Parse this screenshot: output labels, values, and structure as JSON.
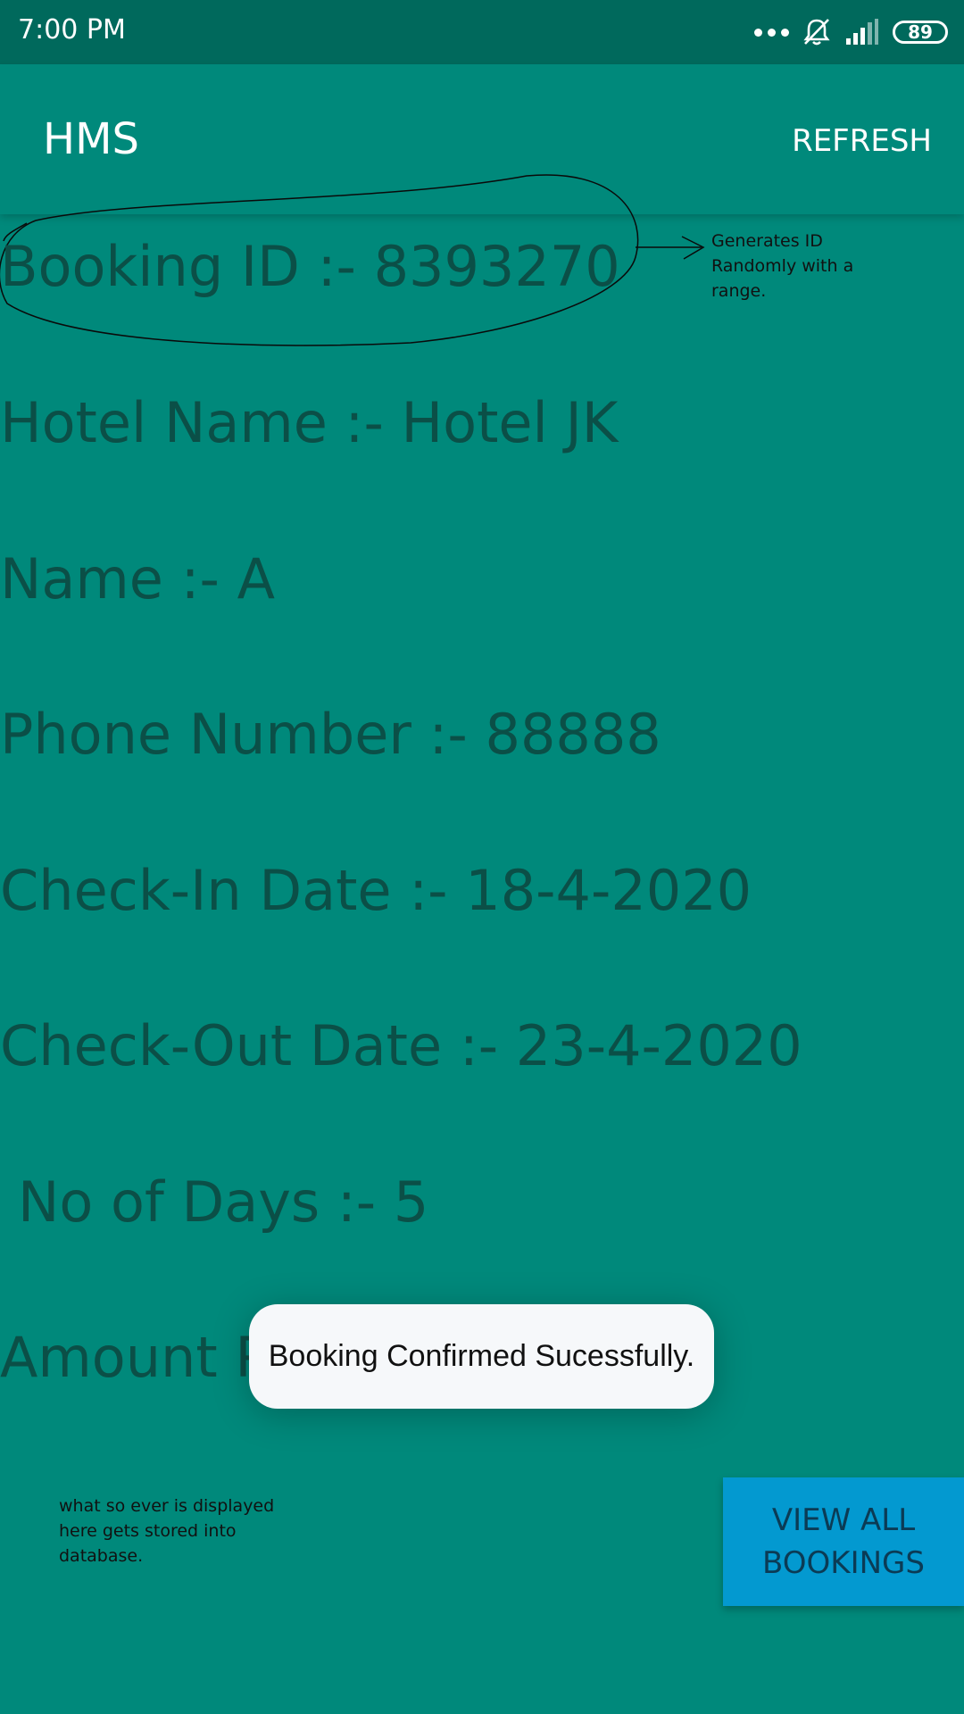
{
  "status_bar": {
    "time": "7:00 PM",
    "battery": "89",
    "icons": [
      "more-dots-icon",
      "bell-off-icon",
      "signal-icon",
      "battery-icon"
    ]
  },
  "app_bar": {
    "title": "HMS",
    "refresh_label": "REFRESH"
  },
  "booking": {
    "booking_id": "Booking ID :- 8393270",
    "hotel_name": "Hotel Name :- Hotel JK",
    "name": "Name :- A",
    "phone": "Phone Number :- 88888",
    "check_in": "Check-In Date :- 18-4-2020",
    "check_out": "Check-Out Date :- 23-4-2020",
    "days": "No of Days :- 5",
    "amount": "Amount Pa"
  },
  "annotations": {
    "id_note": "Generates ID Randomly with a range.",
    "db_note": "what so ever is displayed here gets stored into database."
  },
  "toast": {
    "message": "Booking Confirmed Sucessfully."
  },
  "actions": {
    "view_all_label": "VIEW ALL BOOKINGS"
  },
  "colors": {
    "background": "#00897B",
    "status_bar": "#00695C",
    "text": "#0B4F47",
    "button": "#0399D0"
  }
}
